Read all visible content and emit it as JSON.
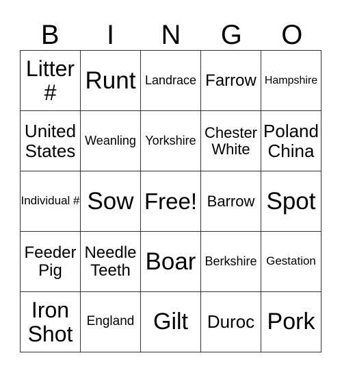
{
  "header": [
    "B",
    "I",
    "N",
    "G",
    "O"
  ],
  "rows": [
    [
      {
        "text": "Litter #",
        "size": 32
      },
      {
        "text": "Runt",
        "size": 35
      },
      {
        "text": "Landrace",
        "size": 18
      },
      {
        "text": "Farrow",
        "size": 24
      },
      {
        "text": "Hampshire",
        "size": 16
      }
    ],
    [
      {
        "text": "United States",
        "size": 26
      },
      {
        "text": "Weanling",
        "size": 18
      },
      {
        "text": "Yorkshire",
        "size": 18
      },
      {
        "text": "Chester White",
        "size": 22
      },
      {
        "text": "Poland China",
        "size": 26
      }
    ],
    [
      {
        "text": "Individual #",
        "size": 17
      },
      {
        "text": "Sow",
        "size": 35
      },
      {
        "text": "Free!",
        "size": 33
      },
      {
        "text": "Barrow",
        "size": 22
      },
      {
        "text": "Spot",
        "size": 35
      }
    ],
    [
      {
        "text": "Feeder Pig",
        "size": 24
      },
      {
        "text": "Needle Teeth",
        "size": 24
      },
      {
        "text": "Boar",
        "size": 35
      },
      {
        "text": "Berkshire",
        "size": 18
      },
      {
        "text": "Gestation",
        "size": 17
      }
    ],
    [
      {
        "text": "Iron Shot",
        "size": 32
      },
      {
        "text": "England",
        "size": 19
      },
      {
        "text": "Gilt",
        "size": 34
      },
      {
        "text": "Duroc",
        "size": 26
      },
      {
        "text": "Pork",
        "size": 34
      }
    ]
  ]
}
